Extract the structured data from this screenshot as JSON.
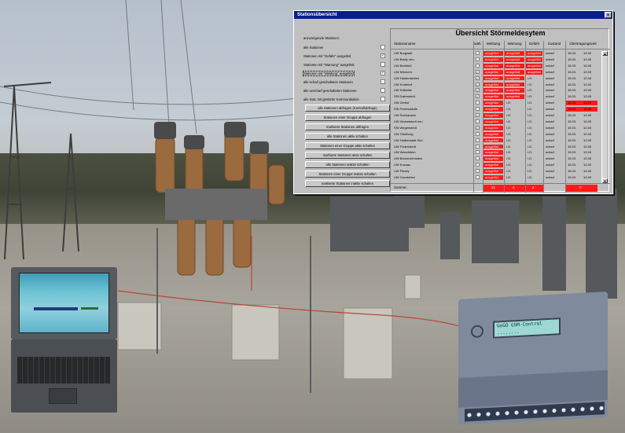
{
  "window": {
    "title": "Stationsübersicht",
    "close_glyph": "×"
  },
  "filters": {
    "heading": "anzuzeigende Stationen:",
    "items": [
      {
        "label": "alle Stationen",
        "checked": ""
      },
      {
        "label": "Stationen mit \"Gefahr\" ausgelöst",
        "checked": "✓"
      },
      {
        "label": "Stationen mit \"Warnung\" ausgelöst",
        "checked": ""
      },
      {
        "label": "Stationen mit \"Meldung\" ausgelöst",
        "checked": "✓"
      },
      {
        "label": "alle scharf geschalteten Stationen",
        "checked": ""
      },
      {
        "label": "alle unscharf geschalteten Stationen",
        "checked": ""
      },
      {
        "label": "alle Stat. mit gestörter Kommunikation",
        "checked": ""
      }
    ]
  },
  "commands": [
    "alle Stationen abfragen (Kontrollabfrage)",
    "Stationen einer Gruppe abfragen",
    "markierte Stationen abfragen",
    "alle Stationen aktiv schalten",
    "Stationen einer Gruppe aktiv schalten",
    "markierte Stationen aktiv schalten",
    "alle Stationen inaktiv schalten",
    "Stationen einer Gruppe inaktiv schalten",
    "markierte Stationen inaktiv schalten"
  ],
  "table": {
    "title": "Übersicht Störmeldesytem",
    "columns": [
      "Stationsname",
      "wäh.",
      "Meldung",
      "Warnung",
      "Gefahr",
      "Zustand",
      "Übertragungszeit"
    ],
    "sum_label": "Summe:",
    "sum_values": [
      "21",
      "4",
      "4",
      "0"
    ],
    "rows": [
      {
        "name": "UW Burgwall",
        "sel": "",
        "meldung": "ausgelöst",
        "warnung": "ausgelöst",
        "gefahr": "ausgelöst",
        "zustand": "scharf",
        "date": "15.03.",
        "time": "12:45"
      },
      {
        "name": "UW Badly neu",
        "sel": "",
        "meldung": "ausgelöst",
        "warnung": "ausgelöst",
        "gefahr": "ausgelöst",
        "zustand": "scharf",
        "date": "15.03.",
        "time": "12:45"
      },
      {
        "name": "UW Berkfeld",
        "sel": "",
        "meldung": "ausgelöst",
        "warnung": "ausgelöst",
        "gefahr": "ausgelöst",
        "zustand": "scharf",
        "date": "15.03.",
        "time": "12:45"
      },
      {
        "name": "UW Möckern",
        "sel": "✓",
        "meldung": "ausgelöst",
        "warnung": "ausgelöst",
        "gefahr": "ausgelöst",
        "zustand": "scharf",
        "date": "15.03.",
        "time": "12:45"
      },
      {
        "name": "UW Haldensleben",
        "sel": "✓",
        "meldung": "ausgelöst",
        "warnung": "ausgelöst",
        "gefahr": "i.O.",
        "zustand": "scharf",
        "date": "15.03.",
        "time": "12:45"
      },
      {
        "name": "UW Krottdorf",
        "sel": "✓",
        "meldung": "ausgelöst",
        "warnung": "ausgelöst",
        "gefahr": "i.O.",
        "zustand": "scharf",
        "date": "15.03.",
        "time": "12:45"
      },
      {
        "name": "UW Kölbelitz",
        "sel": "✓",
        "meldung": "ausgelöst",
        "warnung": "ausgelöst",
        "gefahr": "i.O.",
        "zustand": "scharf",
        "date": "15.03.",
        "time": "12:45"
      },
      {
        "name": "SSt Dalenstedt",
        "sel": "✓",
        "meldung": "ausgelöst",
        "warnung": "ausgelöst",
        "gefahr": "i.O.",
        "zustand": "scharf",
        "date": "15.03.",
        "time": "12:45"
      },
      {
        "name": "UW Zerbst",
        "sel": "",
        "meldung": "ausgelöst",
        "warnung": "i.O.",
        "gefahr": "i.O.",
        "zustand": "scharf",
        "date": "15.03.",
        "time": "12:45"
      },
      {
        "name": "SSt Petersstädte",
        "sel": "",
        "meldung": "ausgelöst",
        "warnung": "i.O.",
        "gefahr": "i.O.",
        "zustand": "scharf",
        "date": "15.03.",
        "time": "12:45"
      },
      {
        "name": "UW Seehausen",
        "sel": "✓",
        "meldung": "ausgelöst",
        "warnung": "i.O.",
        "gefahr": "i.O.",
        "zustand": "scharf",
        "date": "15.03.",
        "time": "12:45"
      },
      {
        "name": "UW Wolmirstedt neu",
        "sel": "",
        "meldung": "ausgelöst",
        "warnung": "i.O.",
        "gefahr": "i.O.",
        "zustand": "scharf",
        "date": "15.03.",
        "time": "12:45"
      },
      {
        "name": "SSt Wegenstedt",
        "sel": "✓",
        "meldung": "ausgelöst",
        "warnung": "i.O.",
        "gefahr": "i.O.",
        "zustand": "scharf",
        "date": "15.03.",
        "time": "12:45"
      },
      {
        "name": "UW Ortelburg",
        "sel": "",
        "meldung": "ausgelöst",
        "warnung": "i.O.",
        "gefahr": "i.O.",
        "zustand": "scharf",
        "date": "15.03.",
        "time": "12:45"
      },
      {
        "name": "UW Halberstadt Süd",
        "sel": "",
        "meldung": "ausgelöst",
        "warnung": "i.O.",
        "gefahr": "i.O.",
        "zustand": "scharf",
        "date": "15.03.",
        "time": "12:45"
      },
      {
        "name": "UW Födenstedt",
        "sel": "",
        "meldung": "ausgelöst",
        "warnung": "i.O.",
        "gefahr": "i.O.",
        "zustand": "scharf",
        "date": "15.03.",
        "time": "12:45"
      },
      {
        "name": "UW Wanzleben",
        "sel": "",
        "meldung": "ausgelöst",
        "warnung": "i.O.",
        "gefahr": "i.O.",
        "zustand": "scharf",
        "date": "15.03.",
        "time": "12:45"
      },
      {
        "name": "UW Benneckenstein",
        "sel": "",
        "meldung": "ausgelöst",
        "warnung": "i.O.",
        "gefahr": "i.O.",
        "zustand": "scharf",
        "date": "15.03.",
        "time": "12:45"
      },
      {
        "name": "UW Kuxaau",
        "sel": "",
        "meldung": "ausgelöst",
        "warnung": "i.O.",
        "gefahr": "i.O.",
        "zustand": "scharf",
        "date": "15.03.",
        "time": "12:45"
      },
      {
        "name": "UW Piksey",
        "sel": "",
        "meldung": "ausgelöst",
        "warnung": "i.O.",
        "gefahr": "i.O.",
        "zustand": "scharf",
        "date": "15.03.",
        "time": "12:45"
      },
      {
        "name": "UW Gunsleben",
        "sel": "",
        "meldung": "ausgelöst",
        "warnung": "i.O.",
        "gefahr": "i.O.",
        "zustand": "scharf",
        "date": "15.03.",
        "time": "12:45"
      }
    ],
    "red_time_rows": [
      8,
      9
    ]
  },
  "device": {
    "display_line1": "GoGO GSM-Control",
    "display_line2": "........"
  },
  "colors": {
    "alarm_red": "#ff1a1a",
    "titlebar": "#0a1e8a"
  }
}
